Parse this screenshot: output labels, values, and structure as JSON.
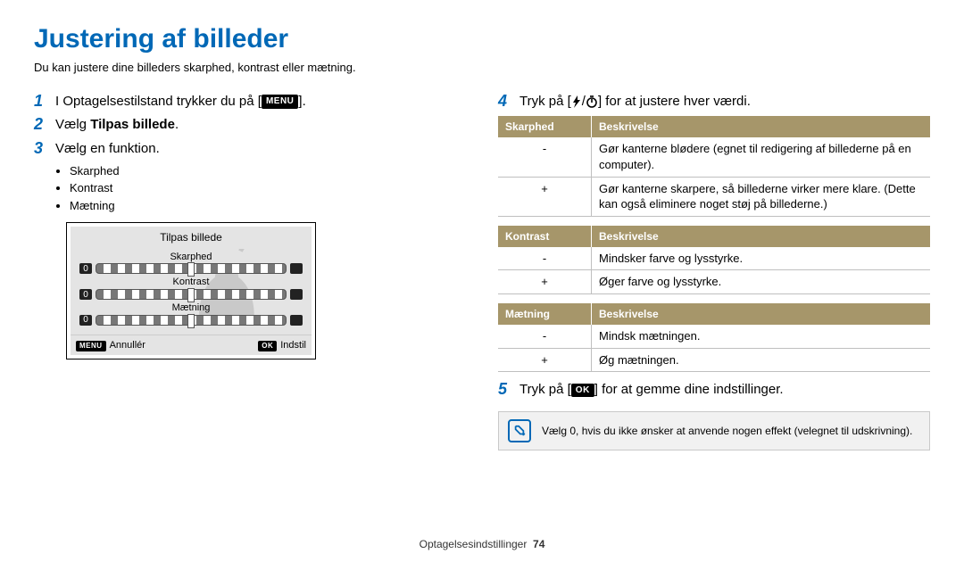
{
  "title": "Justering af billeder",
  "subtitle": "Du kan justere dine billeders skarphed, kontrast eller mætning.",
  "steps": {
    "s1": {
      "num": "1",
      "text_a": "I Optagelsestilstand trykker du på [",
      "text_b": "]."
    },
    "s2": {
      "num": "2",
      "text_a": "Vælg ",
      "bold": "Tilpas billede",
      "text_b": "."
    },
    "s3": {
      "num": "3",
      "text": "Vælg en funktion."
    },
    "s4": {
      "num": "4",
      "text_a": "Tryk på [",
      "text_b": "/",
      "text_c": "] for at justere hver værdi."
    },
    "s5": {
      "num": "5",
      "text_a": "Tryk på [",
      "text_b": "] for at gemme dine indstillinger."
    }
  },
  "bullets": [
    "Skarphed",
    "Kontrast",
    "Mætning"
  ],
  "lcd": {
    "header": "Tilpas billede",
    "rows": [
      {
        "label": "Skarphed",
        "val": "0"
      },
      {
        "label": "Kontrast",
        "val": "0"
      },
      {
        "label": "Mætning",
        "val": "0"
      }
    ],
    "foot_left_badge": "MENU",
    "foot_left": "Annullér",
    "foot_right_badge": "OK",
    "foot_right": "Indstil"
  },
  "tables": {
    "t1": {
      "h1": "Skarphed",
      "h2": "Beskrivelse",
      "rows": [
        {
          "sign": "-",
          "text": "Gør kanterne blødere (egnet til redigering af billederne på en computer)."
        },
        {
          "sign": "+",
          "text": "Gør kanterne skarpere, så billederne virker mere klare. (Dette kan også eliminere noget støj på billederne.)"
        }
      ]
    },
    "t2": {
      "h1": "Kontrast",
      "h2": "Beskrivelse",
      "rows": [
        {
          "sign": "-",
          "text": "Mindsker farve og lysstyrke."
        },
        {
          "sign": "+",
          "text": "Øger farve og lysstyrke."
        }
      ]
    },
    "t3": {
      "h1": "Mætning",
      "h2": "Beskrivelse",
      "rows": [
        {
          "sign": "-",
          "text": "Mindsk mætningen."
        },
        {
          "sign": "+",
          "text": "Øg mætningen."
        }
      ]
    }
  },
  "note": "Vælg 0, hvis du ikke ønsker at anvende nogen effekt (velegnet til udskrivning).",
  "menu_label": "MENU",
  "ok_label": "OK",
  "footer": {
    "section": "Optagelsesindstillinger",
    "page": "74"
  }
}
